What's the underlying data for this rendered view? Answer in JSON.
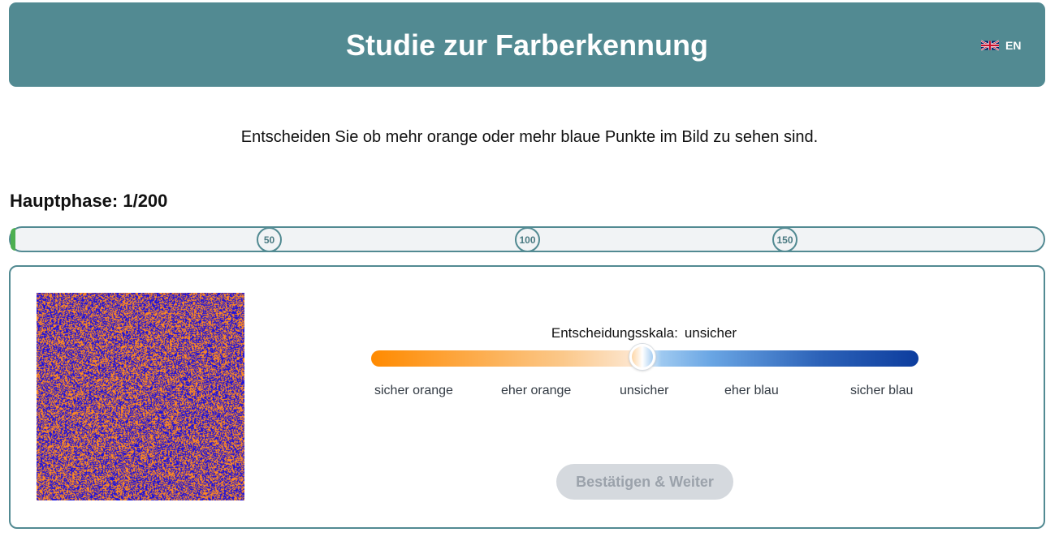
{
  "header": {
    "title": "Studie zur Farberkennung",
    "language": {
      "code": "EN",
      "flag_icon": "uk-flag-icon"
    }
  },
  "instruction": "Entscheiden Sie ob mehr orange oder mehr blaue Punkte im Bild zu sehen sind.",
  "phase": {
    "label": "Hauptphase: 1/200",
    "current": 1,
    "total": 200
  },
  "progress": {
    "milestones": [
      "50",
      "100",
      "150"
    ],
    "color_border": "#528a92",
    "color_fill": "#4caf50"
  },
  "stimulus": {
    "description_colors": {
      "dot_a": "#ff8a1e",
      "dot_b": "#1a0fe0"
    }
  },
  "scale": {
    "title": "Entscheidungsskala:",
    "current_value_label": "unsicher",
    "value_fraction": 0.5,
    "labels": [
      "sicher orange",
      "eher orange",
      "unsicher",
      "eher blau",
      "sicher blau"
    ],
    "colors": {
      "orange": "#ff8a00",
      "blue": "#0d3d9e"
    }
  },
  "confirm_button": {
    "label": "Bestätigen & Weiter",
    "disabled": true
  }
}
